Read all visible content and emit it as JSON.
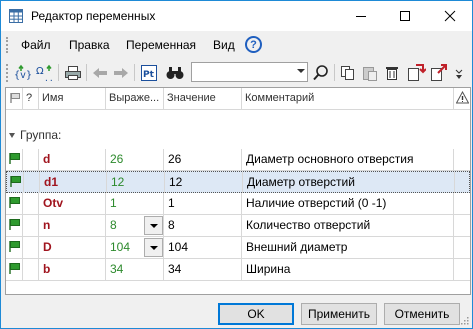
{
  "window": {
    "title": "Редактор переменных",
    "app_icon": "table-icon"
  },
  "menu": {
    "items": [
      "Файл",
      "Правка",
      "Переменная",
      "Вид"
    ],
    "help_symbol": "?"
  },
  "toolbar": {
    "icons": [
      "insert-variable-icon",
      "insert-expression-icon",
      "print-icon",
      "undo-icon",
      "redo-icon",
      "show-icon",
      "find-icon",
      "search-combo",
      "search-icon",
      "copy-icon",
      "paste-icon",
      "delete-icon",
      "import-icon",
      "export-icon",
      "more-icon"
    ],
    "search_value": ""
  },
  "grid": {
    "columns": {
      "q": "?",
      "name": "Имя",
      "expr": "Выраже...",
      "value": "Значение",
      "comment": "Комментарий"
    },
    "group": "Группа:",
    "rows": [
      {
        "name": "d",
        "expr": "26",
        "value": "26",
        "comment": "Диаметр основного отверстия",
        "selected": false,
        "dropdown": false
      },
      {
        "name": "d1",
        "expr": "12",
        "value": "12",
        "comment": "Диаметр отверстий",
        "selected": true,
        "dropdown": false
      },
      {
        "name": "Otv",
        "expr": "1",
        "value": "1",
        "comment": "Наличие отверстий (0 -1)",
        "selected": false,
        "dropdown": false
      },
      {
        "name": "n",
        "expr": "8",
        "value": "8",
        "comment": "Количество отверстий",
        "selected": false,
        "dropdown": true
      },
      {
        "name": "D",
        "expr": "104",
        "value": "104",
        "comment": "Внешний диаметр",
        "selected": false,
        "dropdown": true
      },
      {
        "name": "b",
        "expr": "34",
        "value": "34",
        "comment": "Ширина",
        "selected": false,
        "dropdown": false
      }
    ]
  },
  "buttons": {
    "ok": "OK",
    "apply": "Применить",
    "cancel": "Отменить"
  },
  "colors": {
    "name_text": "#a0141e",
    "expr_text": "#2d8a2d",
    "flag": "#2e9a2e",
    "selected_row": "#dde8f5",
    "accent": "#0078d7"
  }
}
